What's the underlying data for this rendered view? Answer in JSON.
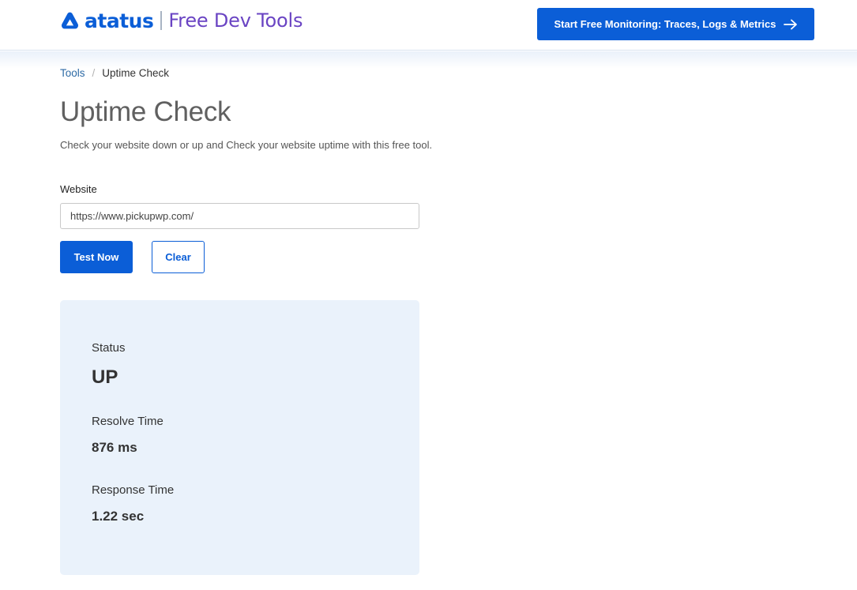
{
  "header": {
    "brand": "atatus",
    "product": "Free Dev Tools",
    "cta_label": "Start Free Monitoring: Traces, Logs & Metrics",
    "cta_icon": "arrow-right-icon"
  },
  "breadcrumb": {
    "root": "Tools",
    "separator": "/",
    "current": "Uptime Check"
  },
  "page": {
    "title": "Uptime Check",
    "subtitle": "Check your website down or up and Check your website uptime with this free tool."
  },
  "form": {
    "website_label": "Website",
    "website_value": "https://www.pickupwp.com/",
    "test_button": "Test Now",
    "clear_button": "Clear"
  },
  "result": {
    "status_label": "Status",
    "status_value": "UP",
    "resolve_label": "Resolve Time",
    "resolve_value": "876 ms",
    "response_label": "Response Time",
    "response_value": "1.22 sec"
  },
  "colors": {
    "brand_blue": "#0b5ed7",
    "product_purple": "#6a44c3",
    "card_bg": "#eaf2fb"
  }
}
